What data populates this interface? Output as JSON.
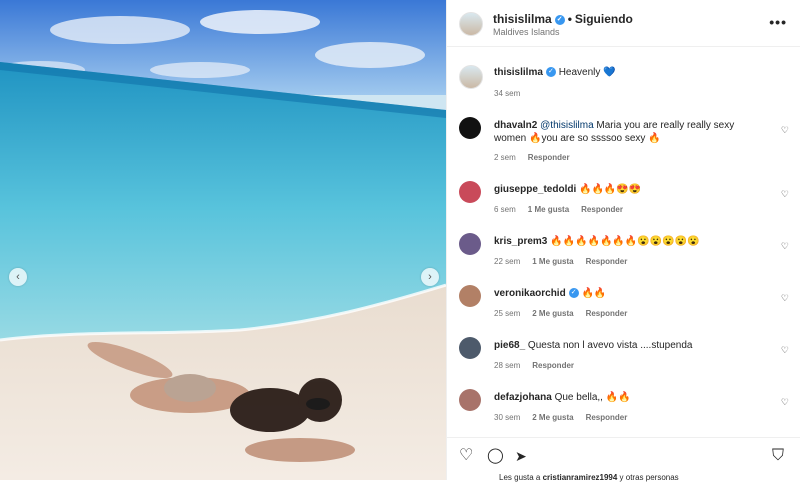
{
  "post": {
    "username": "thisislilma",
    "verified_mark": "✓",
    "separator": "•",
    "follow_status": "Siguiendo",
    "location": "Maldives Islands",
    "more_icon": "•••"
  },
  "caption": {
    "username": "thisislilma",
    "text": "Heavenly 💙",
    "time": "34 sem"
  },
  "comments": [
    {
      "username": "dhavaln2",
      "mention": "@thisislilma",
      "text": " Maria you are really really sexy women 🔥you are so ssssoo sexy 🔥",
      "time": "2 sem",
      "likes": "",
      "reply": "Responder",
      "verified": false,
      "avatar_color": "#111111"
    },
    {
      "username": "giuseppe_tedoldi",
      "mention": "",
      "text": " 🔥🔥🔥😍😍",
      "time": "6 sem",
      "likes": "1 Me gusta",
      "reply": "Responder",
      "verified": false,
      "avatar_color": "#c94a5a"
    },
    {
      "username": "kris_prem3",
      "mention": "",
      "text": " 🔥🔥🔥🔥🔥🔥🔥😮😮😮😮😮",
      "time": "22 sem",
      "likes": "1 Me gusta",
      "reply": "Responder",
      "verified": false,
      "avatar_color": "#6b5b8a"
    },
    {
      "username": "veronikaorchid",
      "mention": "",
      "text": " 🔥🔥",
      "time": "25 sem",
      "likes": "2 Me gusta",
      "reply": "Responder",
      "verified": true,
      "avatar_color": "#b28066"
    },
    {
      "username": "pie68_",
      "mention": "",
      "text": " Questa non l avevo vista ....stupenda",
      "time": "28 sem",
      "likes": "",
      "reply": "Responder",
      "verified": false,
      "avatar_color": "#4d5a6b"
    },
    {
      "username": "defazjohana",
      "mention": "",
      "text": " Que bella,, 🔥🔥",
      "time": "30 sem",
      "likes": "2 Me gusta",
      "reply": "Responder",
      "verified": false,
      "avatar_color": "#a8736a"
    }
  ],
  "icons": {
    "heart_small": "♡",
    "like": "♡",
    "comment": "◯",
    "share": "➤",
    "save": "⛉",
    "prev": "‹",
    "next": "›"
  },
  "likes_line": {
    "prefix": "Les gusta a ",
    "user": "cristianramirez1994",
    "suffix": " y otras personas"
  }
}
